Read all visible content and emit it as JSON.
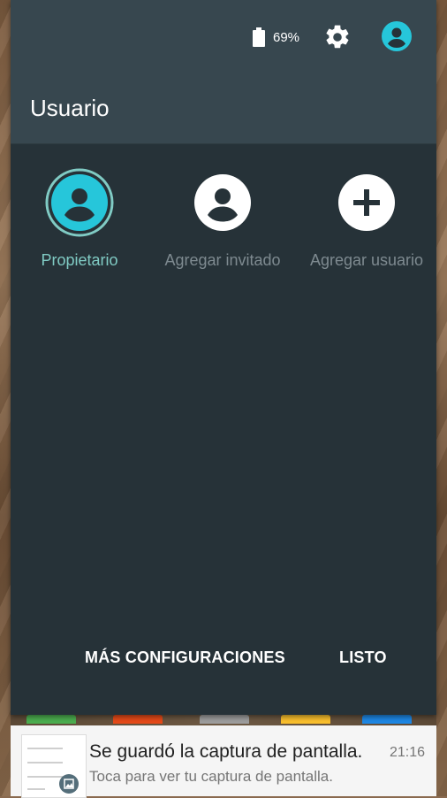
{
  "status": {
    "battery_icon": "battery-icon",
    "battery_percent": "69%",
    "settings_icon": "gear-icon",
    "account_icon": "account-circle-icon"
  },
  "panel": {
    "title": "Usuario",
    "users": [
      {
        "label": "Propietario",
        "icon": "account-circle-icon",
        "active": true
      },
      {
        "label": "Agregar invitado",
        "icon": "account-circle-icon",
        "active": false
      },
      {
        "label": "Agregar usuario",
        "icon": "add-circle-icon",
        "active": false
      }
    ],
    "more_settings_label": "MÁS CONFIGURACIONES",
    "done_label": "LISTO"
  },
  "notification": {
    "title": "Se guardó la captura de pantalla.",
    "time": "21:16",
    "text": "Toca para ver tu captura de pantalla.",
    "thumb_icon": "image-icon"
  },
  "colors": {
    "shade_bg": "#263238",
    "header_bg": "#37474f",
    "accent": "#26c6da",
    "accent_ring": "#80cbc4",
    "secondary_text": "#7e8a90"
  }
}
